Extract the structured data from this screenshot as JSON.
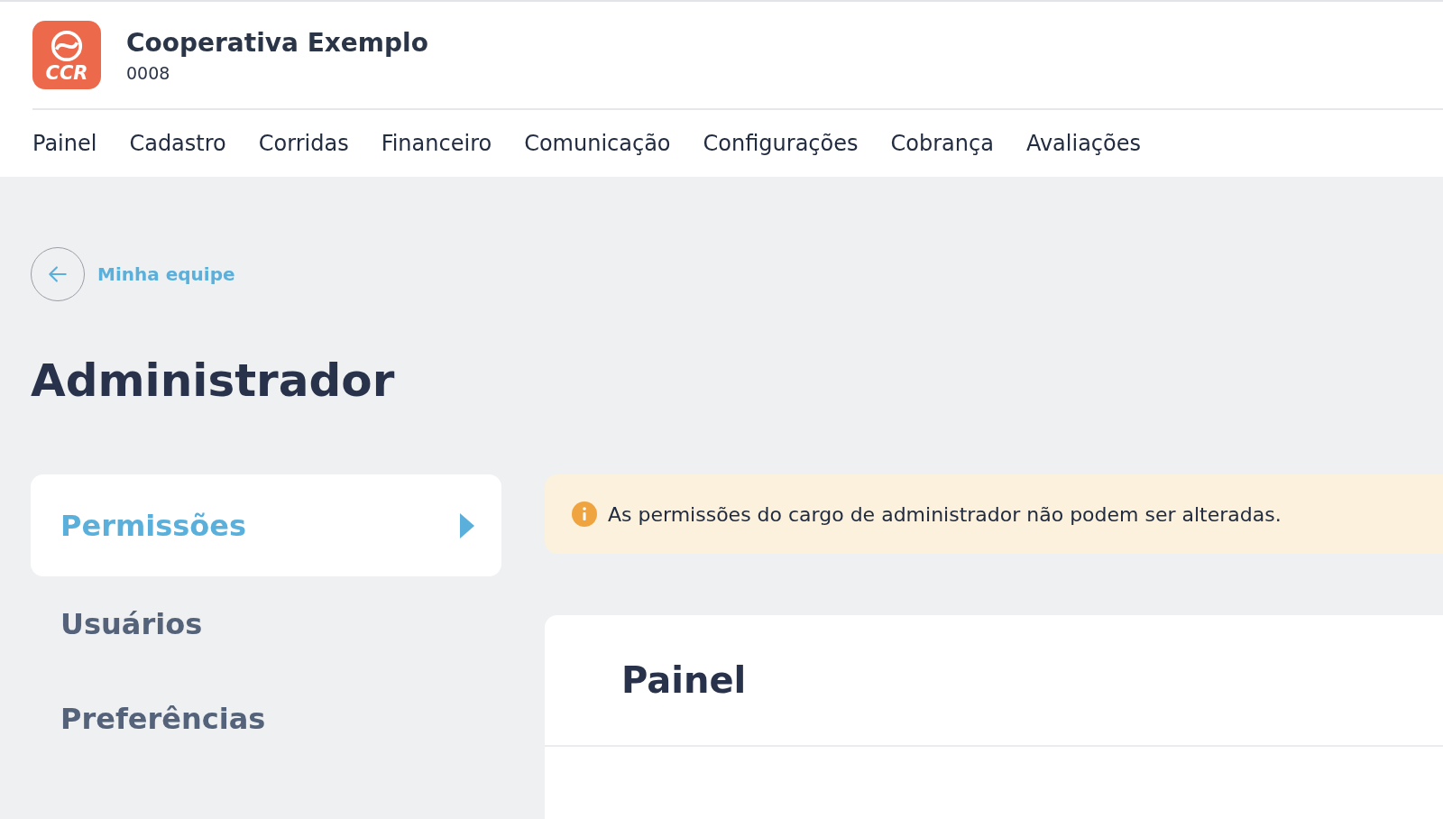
{
  "header": {
    "logo_text": "CCR",
    "title": "Cooperativa Exemplo",
    "subtitle": "0008"
  },
  "nav": [
    {
      "label": "Painel"
    },
    {
      "label": "Cadastro"
    },
    {
      "label": "Corridas"
    },
    {
      "label": "Financeiro"
    },
    {
      "label": "Comunicação"
    },
    {
      "label": "Configurações"
    },
    {
      "label": "Cobrança"
    },
    {
      "label": "Avaliações"
    }
  ],
  "back_link": {
    "label": "Minha equipe"
  },
  "page_title": "Administrador",
  "sidebar": {
    "items": [
      {
        "label": "Permissões",
        "selected": true
      },
      {
        "label": "Usuários",
        "selected": false
      },
      {
        "label": "Preferências",
        "selected": false
      }
    ]
  },
  "alert": {
    "text": "As permissões do cargo de administrador não podem ser alteradas."
  },
  "section": {
    "title": "Painel"
  }
}
